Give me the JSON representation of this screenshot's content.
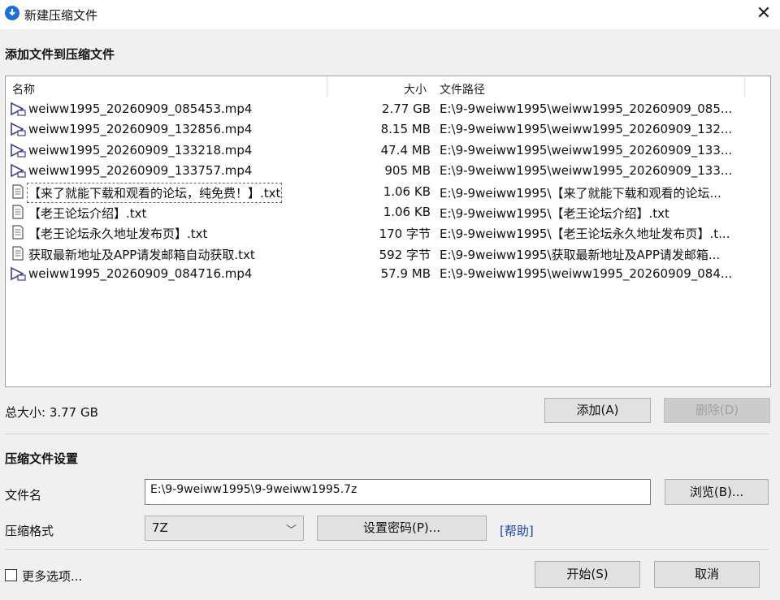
{
  "window": {
    "title": "新建压缩文件",
    "close_glyph": "✕"
  },
  "add_section": {
    "title": "添加文件到压缩文件"
  },
  "list": {
    "columns": {
      "name": "名称",
      "size": "大小",
      "path": "文件路径"
    },
    "rows": [
      {
        "icon": "video-file-icon",
        "name": "weiww1995_20260909_085453.mp4",
        "size": "2.77 GB",
        "path": "E:\\9-9weiww1995\\weiww1995_20260909_085..."
      },
      {
        "icon": "video-file-icon",
        "name": "weiww1995_20260909_132856.mp4",
        "size": "8.15 MB",
        "path": "E:\\9-9weiww1995\\weiww1995_20260909_132..."
      },
      {
        "icon": "video-file-icon",
        "name": "weiww1995_20260909_133218.mp4",
        "size": "47.4 MB",
        "path": "E:\\9-9weiww1995\\weiww1995_20260909_133..."
      },
      {
        "icon": "video-file-icon",
        "name": "weiww1995_20260909_133757.mp4",
        "size": "905 MB",
        "path": "E:\\9-9weiww1995\\weiww1995_20260909_133..."
      },
      {
        "icon": "text-file-icon",
        "name": "【来了就能下载和观看的论坛，纯免费！】.txt",
        "size": "1.06 KB",
        "path": "E:\\9-9weiww1995\\【来了就能下载和观看的论坛..."
      },
      {
        "icon": "text-file-icon",
        "name": "【老王论坛介绍】.txt",
        "size": "1.06 KB",
        "path": "E:\\9-9weiww1995\\【老王论坛介绍】.txt"
      },
      {
        "icon": "text-file-icon",
        "name": "【老王论坛永久地址发布页】.txt",
        "size": "170 字节",
        "path": "E:\\9-9weiww1995\\【老王论坛永久地址发布页】.t..."
      },
      {
        "icon": "text-file-icon",
        "name": "获取最新地址及APP请发邮箱自动获取.txt",
        "size": "592 字节",
        "path": "E:\\9-9weiww1995\\获取最新地址及APP请发邮箱..."
      },
      {
        "icon": "video-file-icon",
        "name": "weiww1995_20260909_084716.mp4",
        "size": "57.9 MB",
        "path": "E:\\9-9weiww1995\\weiww1995_20260909_084..."
      }
    ]
  },
  "total_size": "总大小: 3.77 GB",
  "buttons": {
    "add": "添加(A)",
    "delete": "删除(D)",
    "browse": "浏览(B)...",
    "set_password": "设置密码(P)...",
    "start": "开始(S)",
    "cancel": "取消"
  },
  "settings": {
    "title": "压缩文件设置",
    "filename_label": "文件名",
    "filename_value": "E:\\9-9weiww1995\\9-9weiww1995.7z",
    "format_label": "压缩格式",
    "format_value": "7Z",
    "help_link": "[帮助]"
  },
  "more_options": {
    "label": "更多选项...",
    "checked": false
  }
}
